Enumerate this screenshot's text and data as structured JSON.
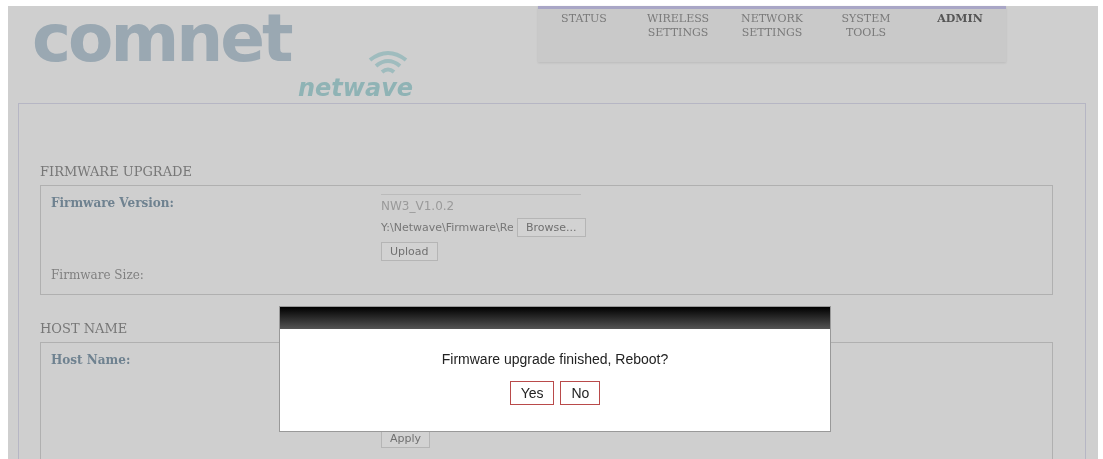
{
  "logo": {
    "brand": "comnet",
    "product": "netwave"
  },
  "tabs": [
    {
      "label": "STATUS",
      "selected": false
    },
    {
      "label": "WIRELESS SETTINGS",
      "selected": false
    },
    {
      "label": "NETWORK SETTINGS",
      "selected": false
    },
    {
      "label": "SYSTEM TOOLS",
      "selected": false
    },
    {
      "label": "ADMIN",
      "selected": true
    }
  ],
  "firmware_upgrade": {
    "title": "FIRMWARE UPGRADE",
    "version_label": "Firmware Version:",
    "version": "NW3_V1.0.2",
    "file_value": "Y:\\Netwave\\Firmware\\Re",
    "browse": "Browse...",
    "upload": "Upload",
    "size_label": "Firmware Size:"
  },
  "host_name": {
    "title": "HOST NAME",
    "label": "Host Name:",
    "apply": "Apply"
  },
  "dialog": {
    "message": "Firmware upgrade finished, Reboot?",
    "buttons": [
      "Yes",
      "No"
    ]
  }
}
